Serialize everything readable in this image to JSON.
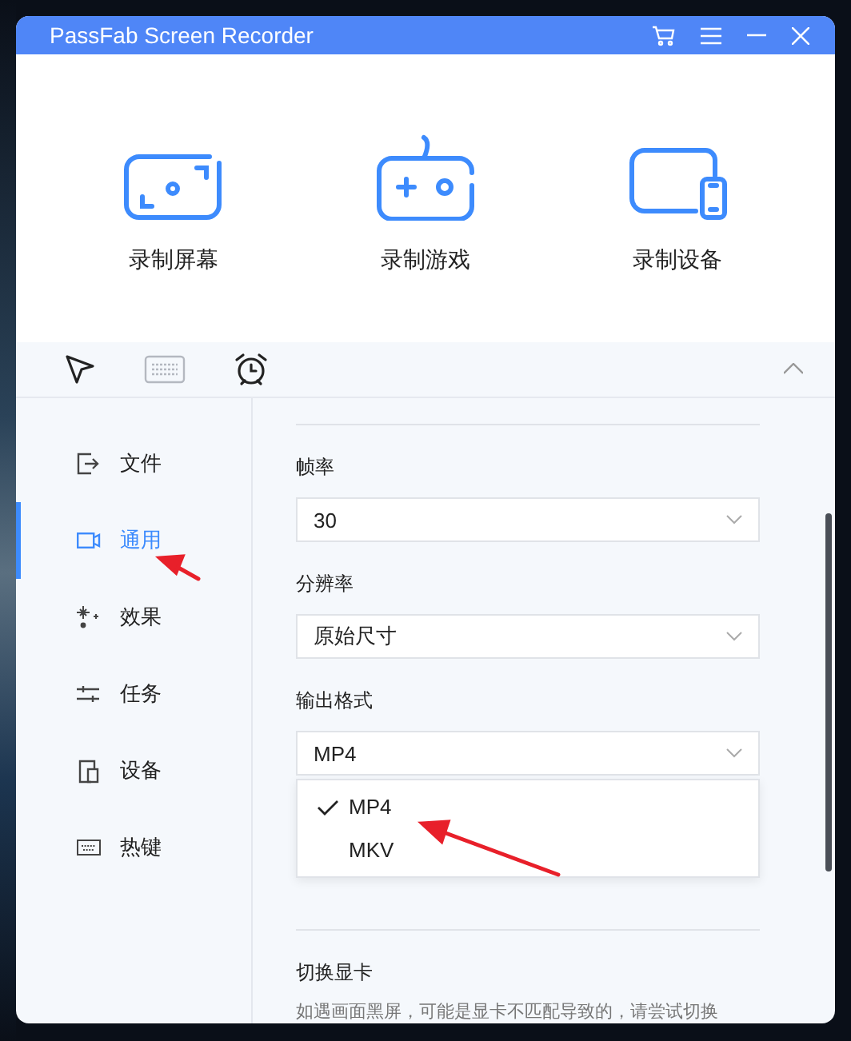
{
  "window": {
    "title": "PassFab Screen Recorder"
  },
  "modes": [
    {
      "label": "录制屏幕",
      "kind": "screen"
    },
    {
      "label": "录制游戏",
      "kind": "game"
    },
    {
      "label": "录制设备",
      "kind": "device"
    }
  ],
  "toolbar": [
    {
      "kind": "cursor",
      "disabled": false
    },
    {
      "kind": "keyboard",
      "disabled": true
    },
    {
      "kind": "alarm",
      "disabled": false
    }
  ],
  "sidebar": {
    "items": [
      {
        "label": "文件",
        "kind": "file",
        "selected": false
      },
      {
        "label": "通用",
        "kind": "camera",
        "selected": true
      },
      {
        "label": "效果",
        "kind": "sparkle",
        "selected": false
      },
      {
        "label": "任务",
        "kind": "sliders",
        "selected": false
      },
      {
        "label": "设备",
        "kind": "device",
        "selected": false
      },
      {
        "label": "热键",
        "kind": "keyboard",
        "selected": false
      }
    ]
  },
  "settings": [
    {
      "label": "帧率",
      "value": "30"
    },
    {
      "label": "分辨率",
      "value": "原始尺寸"
    },
    {
      "label": "输出格式",
      "value": "MP4",
      "options": [
        {
          "label": "MP4",
          "selected": true
        },
        {
          "label": "MKV",
          "selected": false
        }
      ]
    }
  ],
  "gpu": {
    "title": "切换显卡",
    "description": "如遇画面黑屏，可能是显卡不匹配导致的，请尝试切换"
  }
}
